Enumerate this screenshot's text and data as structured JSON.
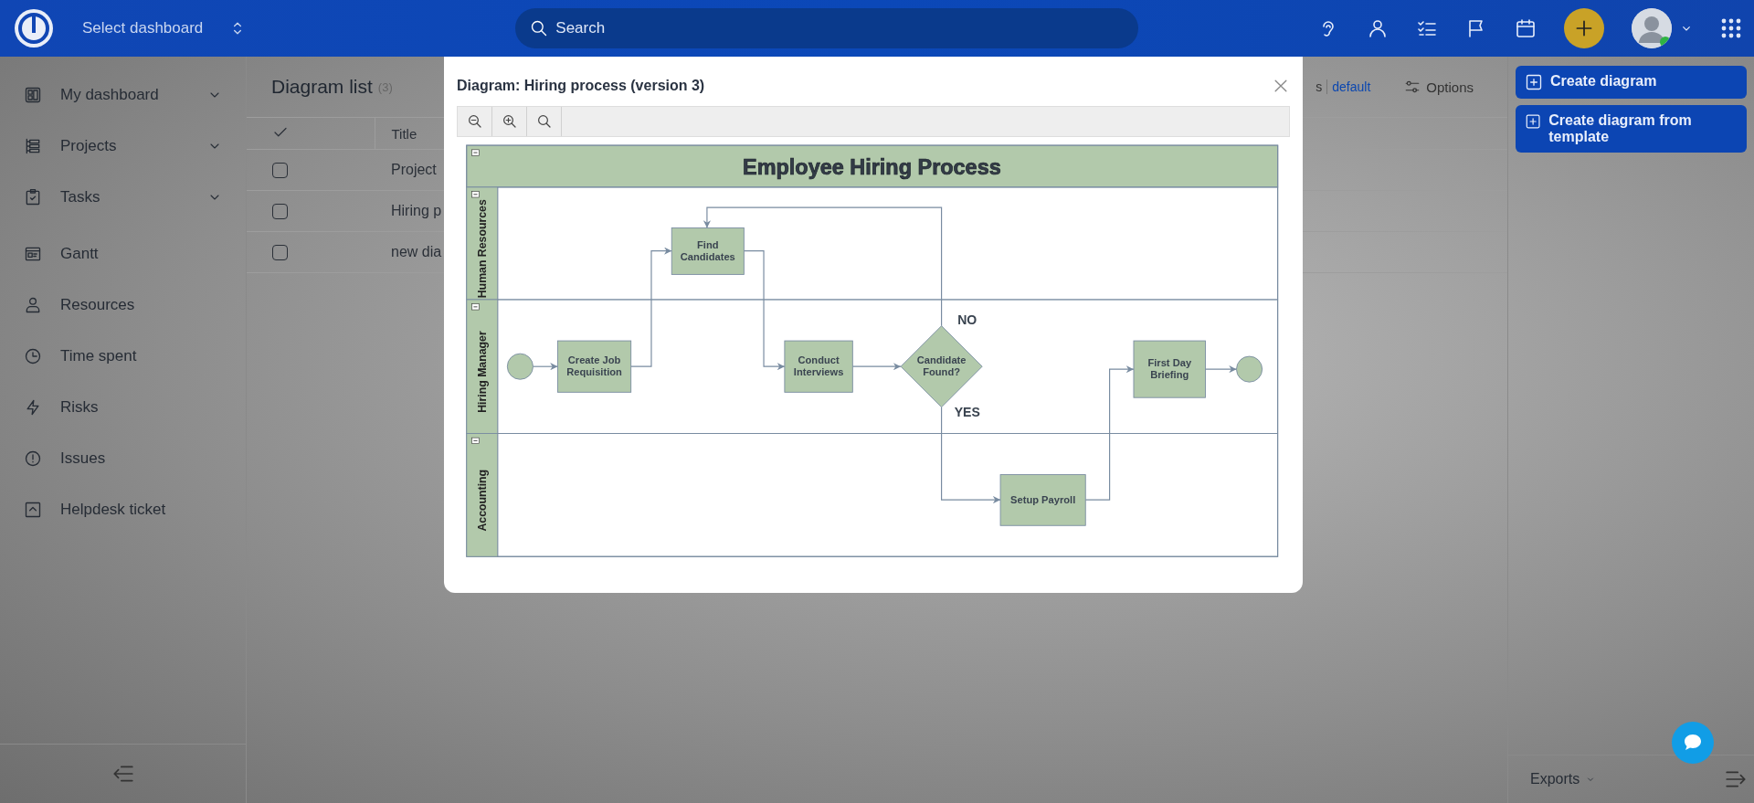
{
  "topbar": {
    "dashboard_selector": "Select dashboard",
    "search": {
      "placeholder": "Search"
    }
  },
  "sidebar": {
    "items": [
      {
        "label": "My dashboard",
        "expandable": true
      },
      {
        "label": "Projects",
        "expandable": true
      },
      {
        "label": "Tasks",
        "expandable": true
      },
      {
        "label": "Gantt",
        "expandable": false
      },
      {
        "label": "Resources",
        "expandable": false
      },
      {
        "label": "Time spent",
        "expandable": false
      },
      {
        "label": "Risks",
        "expandable": false
      },
      {
        "label": "Issues",
        "expandable": false
      },
      {
        "label": "Helpdesk ticket",
        "expandable": false
      }
    ]
  },
  "list": {
    "title": "Diagram list",
    "count": "(3)",
    "toolbar": {
      "column_fragment": "s",
      "view": "default",
      "options": "Options"
    },
    "columns": [
      "Title"
    ],
    "rows": [
      {
        "title": "Project",
        "checked": false
      },
      {
        "title": "Hiring p",
        "checked": false
      },
      {
        "title": "new dia",
        "checked": false
      }
    ]
  },
  "actions": [
    "Create diagram",
    "Create diagram from template"
  ],
  "footer": {
    "exports": "Exports"
  },
  "modal": {
    "title": "Diagram: Hiring process (version 3)",
    "diagram": {
      "title": "Employee Hiring Process",
      "lanes": [
        {
          "label": "Human Resources"
        },
        {
          "label": "Hiring Manager"
        },
        {
          "label": "Accounting"
        }
      ],
      "nodes": [
        {
          "kind": "event"
        },
        {
          "kind": "task",
          "label": "Create Job Requisition"
        },
        {
          "kind": "task",
          "label": "Find Candidates"
        },
        {
          "kind": "task",
          "label": "Conduct Interviews"
        },
        {
          "kind": "decision",
          "label": "Candidate Found?"
        },
        {
          "kind": "task",
          "label": "Setup Payroll"
        },
        {
          "kind": "task",
          "label": "First Day Briefing"
        },
        {
          "kind": "event"
        }
      ],
      "edge_labels": [
        "NO",
        "YES"
      ]
    }
  }
}
